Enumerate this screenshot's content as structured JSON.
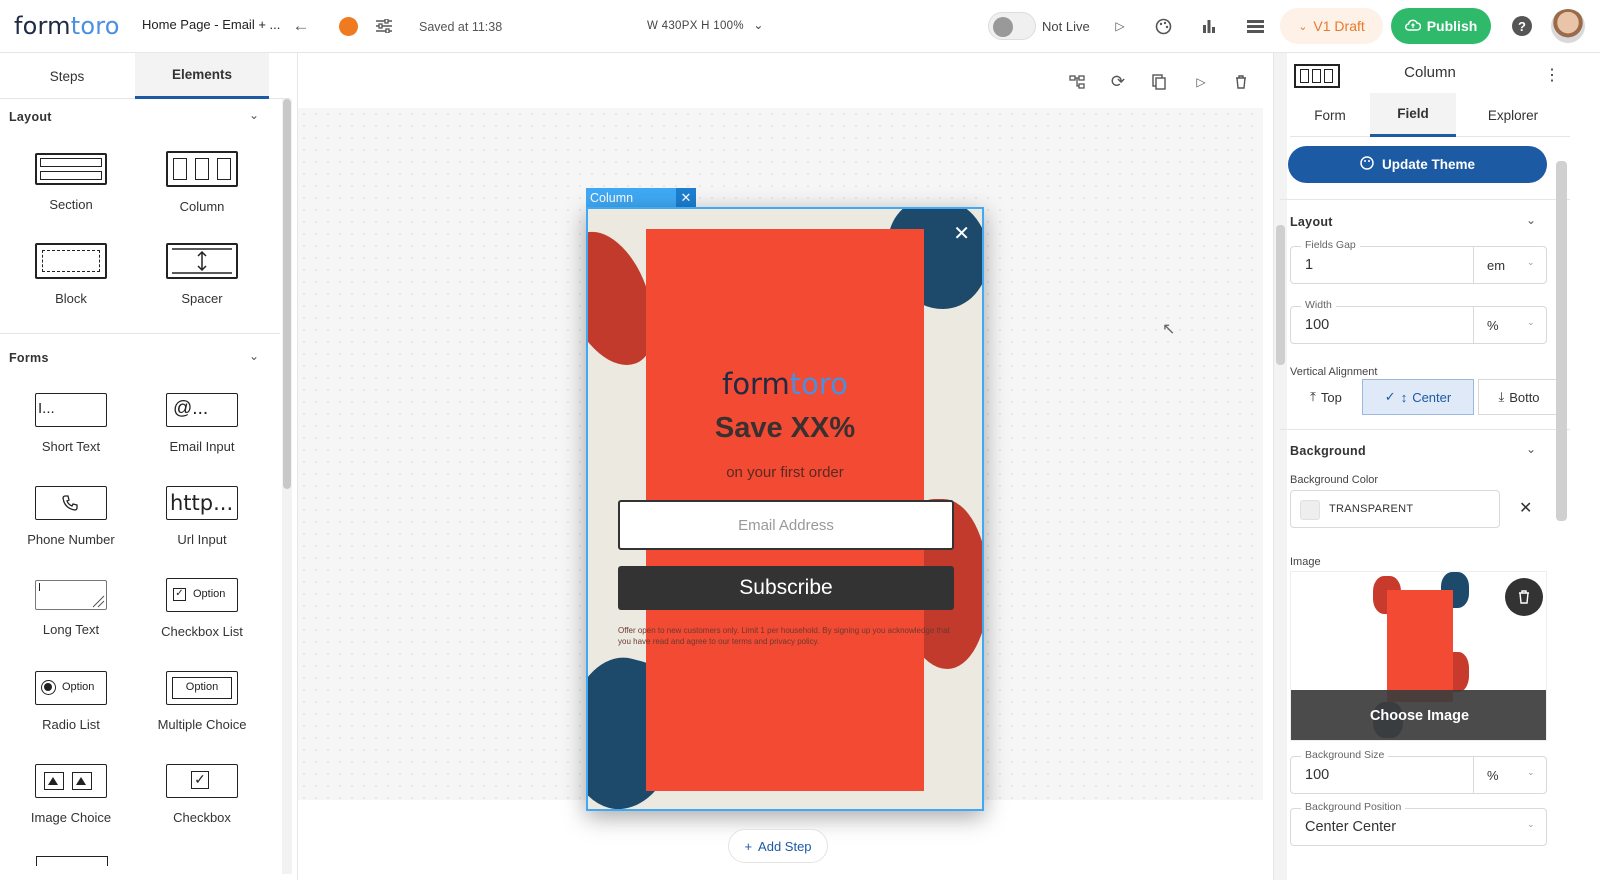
{
  "topbar": {
    "logo_main": "form",
    "logo_accent": "toro",
    "page_title": "Home Page - Email + ...",
    "saved": "Saved at 11:38",
    "dims": "W 430PX  H 100%",
    "live_label": "Not Live",
    "draft_label": "V1 Draft",
    "publish_label": "Publish",
    "help": "?"
  },
  "left": {
    "tabs": [
      "Steps",
      "Elements"
    ],
    "layout_head": "Layout",
    "layout_items": [
      "Section",
      "Column",
      "Block",
      "Spacer"
    ],
    "forms_head": "Forms",
    "form_items": [
      "Short Text",
      "Email Input",
      "Phone Number",
      "Url Input",
      "Long Text",
      "Checkbox List",
      "Radio List",
      "Multiple Choice",
      "Image Choice",
      "Checkbox"
    ],
    "icon_text": {
      "short": "I...",
      "email": "@...",
      "url": "http...",
      "option": "Option"
    }
  },
  "canvas": {
    "column_tag": "Column",
    "add_step": "Add Step",
    "popup": {
      "logo_main": "form",
      "logo_accent": "toro",
      "headline": "Save XX%",
      "subheadline": "on your first order",
      "email_placeholder": "Email Address",
      "button": "Subscribe",
      "fineprint": "Offer open to new customers only. Limit 1 per household. By signing up you acknowledge that you have read and agree to our terms and privacy policy."
    }
  },
  "right": {
    "title": "Column",
    "tabs": [
      "Form",
      "Field",
      "Explorer"
    ],
    "update_theme": "Update Theme",
    "layout_head": "Layout",
    "fields_gap": {
      "label": "Fields Gap",
      "value": "1",
      "unit": "em"
    },
    "width": {
      "label": "Width",
      "value": "100",
      "unit": "%"
    },
    "valign_label": "Vertical Alignment",
    "valign_options": [
      "Top",
      "Center",
      "Botto"
    ],
    "background_head": "Background",
    "bg_color_label": "Background Color",
    "bg_color_value": "TRANSPARENT",
    "image_label": "Image",
    "choose_image": "Choose Image",
    "bg_size": {
      "label": "Background Size",
      "value": "100",
      "unit": "%"
    },
    "bg_position": {
      "label": "Background Position",
      "value": "Center Center"
    }
  },
  "colors": {
    "accent_blue": "#1c5aa3",
    "publish_green": "#2fb96b",
    "popup_red": "#f24a33",
    "draft_orange": "#e87a2a"
  }
}
